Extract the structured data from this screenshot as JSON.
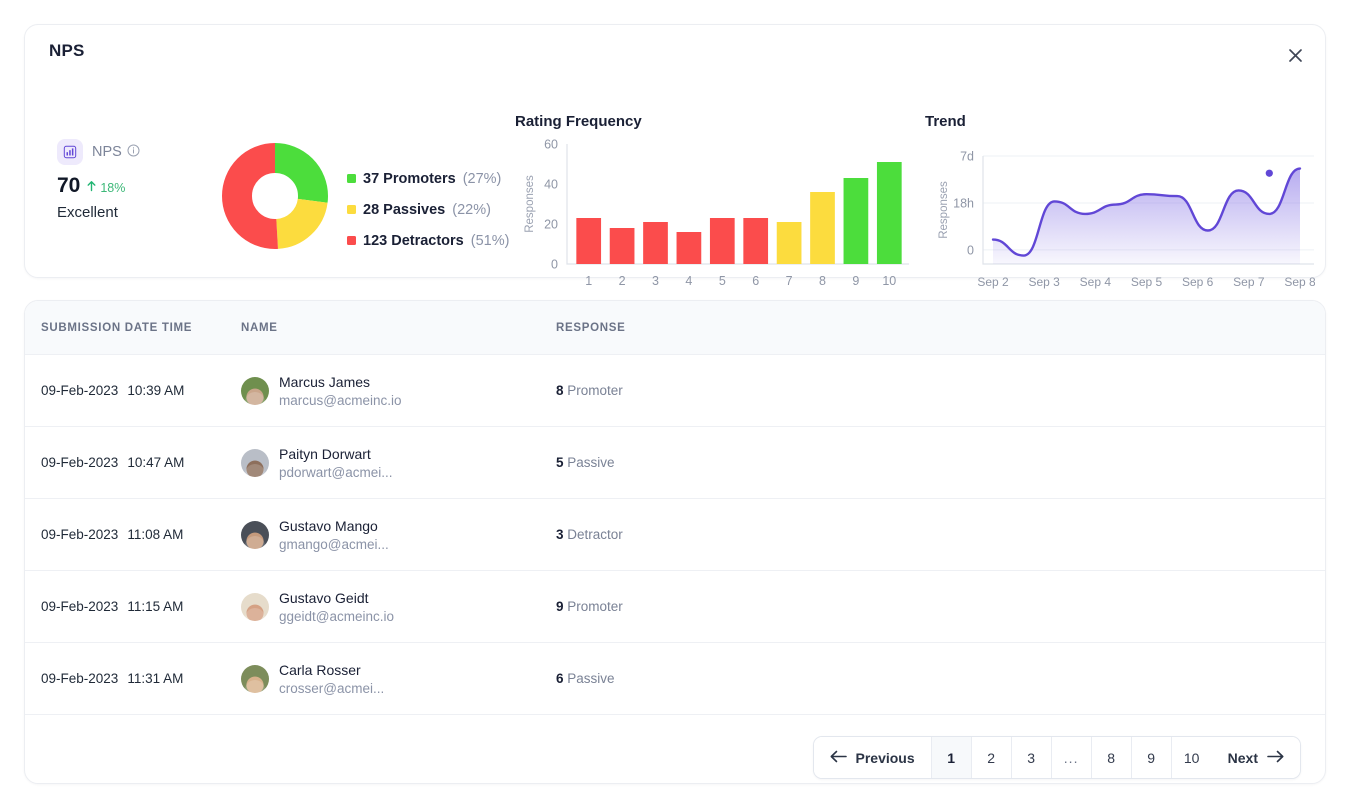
{
  "card": {
    "title": "NPS",
    "close_icon": "close-icon"
  },
  "metric": {
    "badge_icon": "bar-chart-icon",
    "name": "NPS",
    "info_icon": "info-icon",
    "value": "70",
    "trend_icon": "arrow-up-icon",
    "delta": "18%",
    "label": "Excellent"
  },
  "donut": {
    "segments": [
      {
        "label": "Promoters",
        "count": 37,
        "percent": 27,
        "color": "#4cdd3c"
      },
      {
        "label": "Passives",
        "count": 28,
        "percent": 22,
        "color": "#fcdc3e"
      },
      {
        "label": "Detractors",
        "count": 123,
        "percent": 51,
        "color": "#fb4c4c"
      }
    ]
  },
  "legend": [
    {
      "swatch": "#4cdd3c",
      "main": "37 Promoters",
      "pct": "(27%)"
    },
    {
      "swatch": "#fcdc3e",
      "main": "28 Passives",
      "pct": "(22%)"
    },
    {
      "swatch": "#fb4c4c",
      "main": "123 Detractors",
      "pct": "(51%)"
    }
  ],
  "chart_data": [
    {
      "type": "bar",
      "title": "Rating Frequency",
      "xlabel": "",
      "ylabel": "Responses",
      "categories": [
        "1",
        "2",
        "3",
        "4",
        "5",
        "6",
        "7",
        "8",
        "9",
        "10"
      ],
      "values": [
        23,
        18,
        21,
        16,
        23,
        23,
        21,
        36,
        43,
        51
      ],
      "colors": [
        "#fb4c4c",
        "#fb4c4c",
        "#fb4c4c",
        "#fb4c4c",
        "#fb4c4c",
        "#fb4c4c",
        "#fcdc3e",
        "#fcdc3e",
        "#4cdd3c",
        "#4cdd3c"
      ],
      "ylim": [
        0,
        60
      ],
      "yticks": [
        "0",
        "20",
        "40",
        "60"
      ],
      "grid": false,
      "legend": "none"
    },
    {
      "type": "area",
      "title": "Trend",
      "xlabel": "",
      "ylabel": "Responses",
      "x": [
        "Sep 2",
        "Sep 3",
        "Sep 4",
        "Sep 5",
        "Sep 6",
        "Sep 7",
        "Sep 8"
      ],
      "yticks": [
        "0",
        "18h",
        "7d"
      ],
      "values": [
        0.33,
        1.55,
        1.3,
        1.75,
        0.85,
        1.9,
        2.6
      ],
      "line_color": "#6147d6",
      "fill_color": "#8b79e6",
      "marker": {
        "x": "Sep 7.5",
        "y": 2.45,
        "color": "#6147d6"
      },
      "grid": true,
      "legend": "none"
    }
  ],
  "table": {
    "columns": [
      "Submission Date Time",
      "Name",
      "Response"
    ],
    "rows": [
      {
        "date": "09-Feb-2023",
        "time": "10:39 AM",
        "name": "Marcus James",
        "email": "marcus@acmeinc.io",
        "score": "8",
        "category": "Promoter",
        "avatar_color_a": "#6f8f4e",
        "avatar_color_b": "#caa68b"
      },
      {
        "date": "09-Feb-2023",
        "time": "10:47 AM",
        "name": "Paityn Dorwart",
        "email": "pdorwart@acmei...",
        "score": "5",
        "category": "Passive",
        "avatar_color_a": "#b9bec7",
        "avatar_color_b": "#8d6f5c"
      },
      {
        "date": "09-Feb-2023",
        "time": "11:08 AM",
        "name": "Gustavo Mango",
        "email": "gmango@acmei...",
        "score": "3",
        "category": "Detractor",
        "avatar_color_a": "#4a4f58",
        "avatar_color_b": "#c59a7c"
      },
      {
        "date": "09-Feb-2023",
        "time": "11:15 AM",
        "name": "Gustavo Geidt",
        "email": "ggeidt@acmeinc.io",
        "score": "9",
        "category": "Promoter",
        "avatar_color_a": "#e6dccb",
        "avatar_color_b": "#d5a184"
      },
      {
        "date": "09-Feb-2023",
        "time": "11:31 AM",
        "name": "Carla Rosser",
        "email": "crosser@acmei...",
        "score": "6",
        "category": "Passive",
        "avatar_color_a": "#7d8d5b",
        "avatar_color_b": "#d8b28c"
      }
    ]
  },
  "pagination": {
    "previous_label": "Previous",
    "previous_icon": "arrow-left-icon",
    "next_label": "Next",
    "next_icon": "arrow-right-icon",
    "pages": [
      "1",
      "2",
      "3",
      "...",
      "8",
      "9",
      "10"
    ],
    "active_page": "1"
  }
}
